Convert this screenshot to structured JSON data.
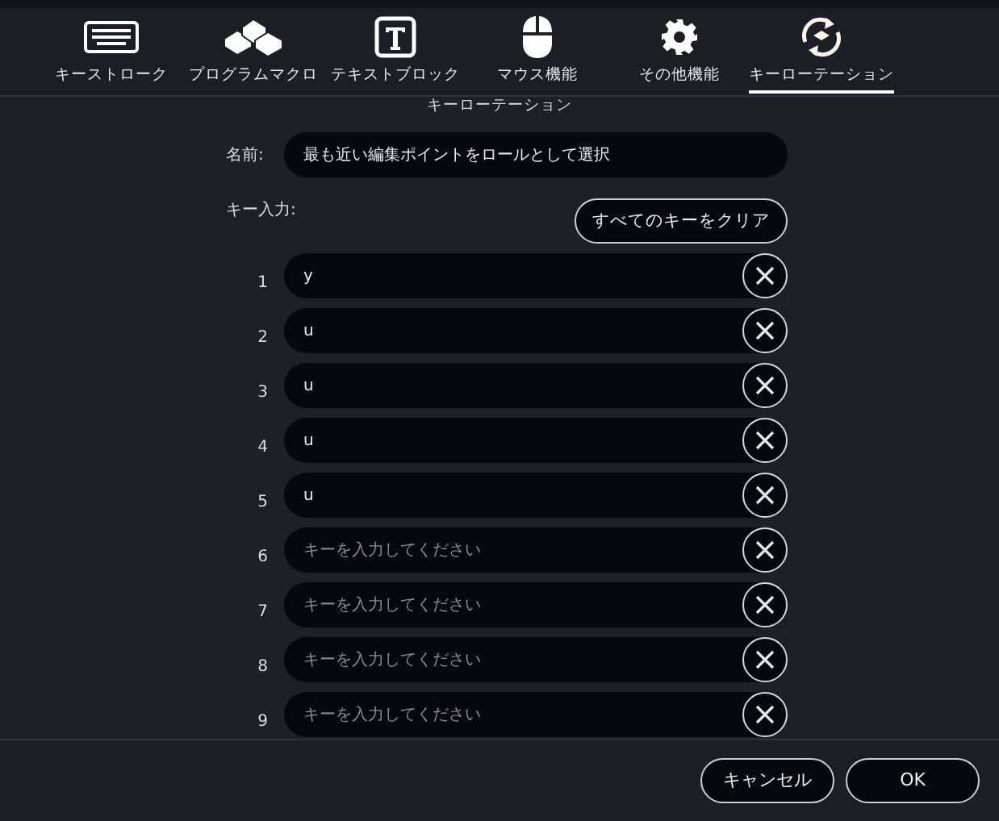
{
  "tabs": [
    {
      "kind": "keyboard",
      "label": "キーストローク",
      "selected": false
    },
    {
      "kind": "keys",
      "label": "プログラムマクロ",
      "selected": false
    },
    {
      "kind": "text",
      "label": "テキストブロック",
      "selected": false
    },
    {
      "kind": "mouse",
      "label": "マウス機能",
      "selected": false
    },
    {
      "kind": "gear",
      "label": "その他機能",
      "selected": false
    },
    {
      "kind": "rotation",
      "label": "キーローテーション",
      "selected": true
    }
  ],
  "heading": "キーローテーション",
  "name": {
    "label": "名前:",
    "value": "最も近い編集ポイントをロールとして選択"
  },
  "key_input": {
    "label": "キー入力:",
    "clear_button": "すべてのキーをクリア"
  },
  "keys": [
    {
      "number": "1",
      "value": "y"
    },
    {
      "number": "2",
      "value": "u"
    },
    {
      "number": "3",
      "value": "u"
    },
    {
      "number": "4",
      "value": "u"
    },
    {
      "number": "5",
      "value": "u"
    },
    {
      "number": "6",
      "placeholder": "キーを入力してください"
    },
    {
      "number": "7",
      "placeholder": "キーを入力してください"
    },
    {
      "number": "8",
      "placeholder": "キーを入力してください"
    },
    {
      "number": "9",
      "placeholder": "キーを入力してください"
    }
  ],
  "buttons": [
    "キャンセル",
    "OK"
  ]
}
